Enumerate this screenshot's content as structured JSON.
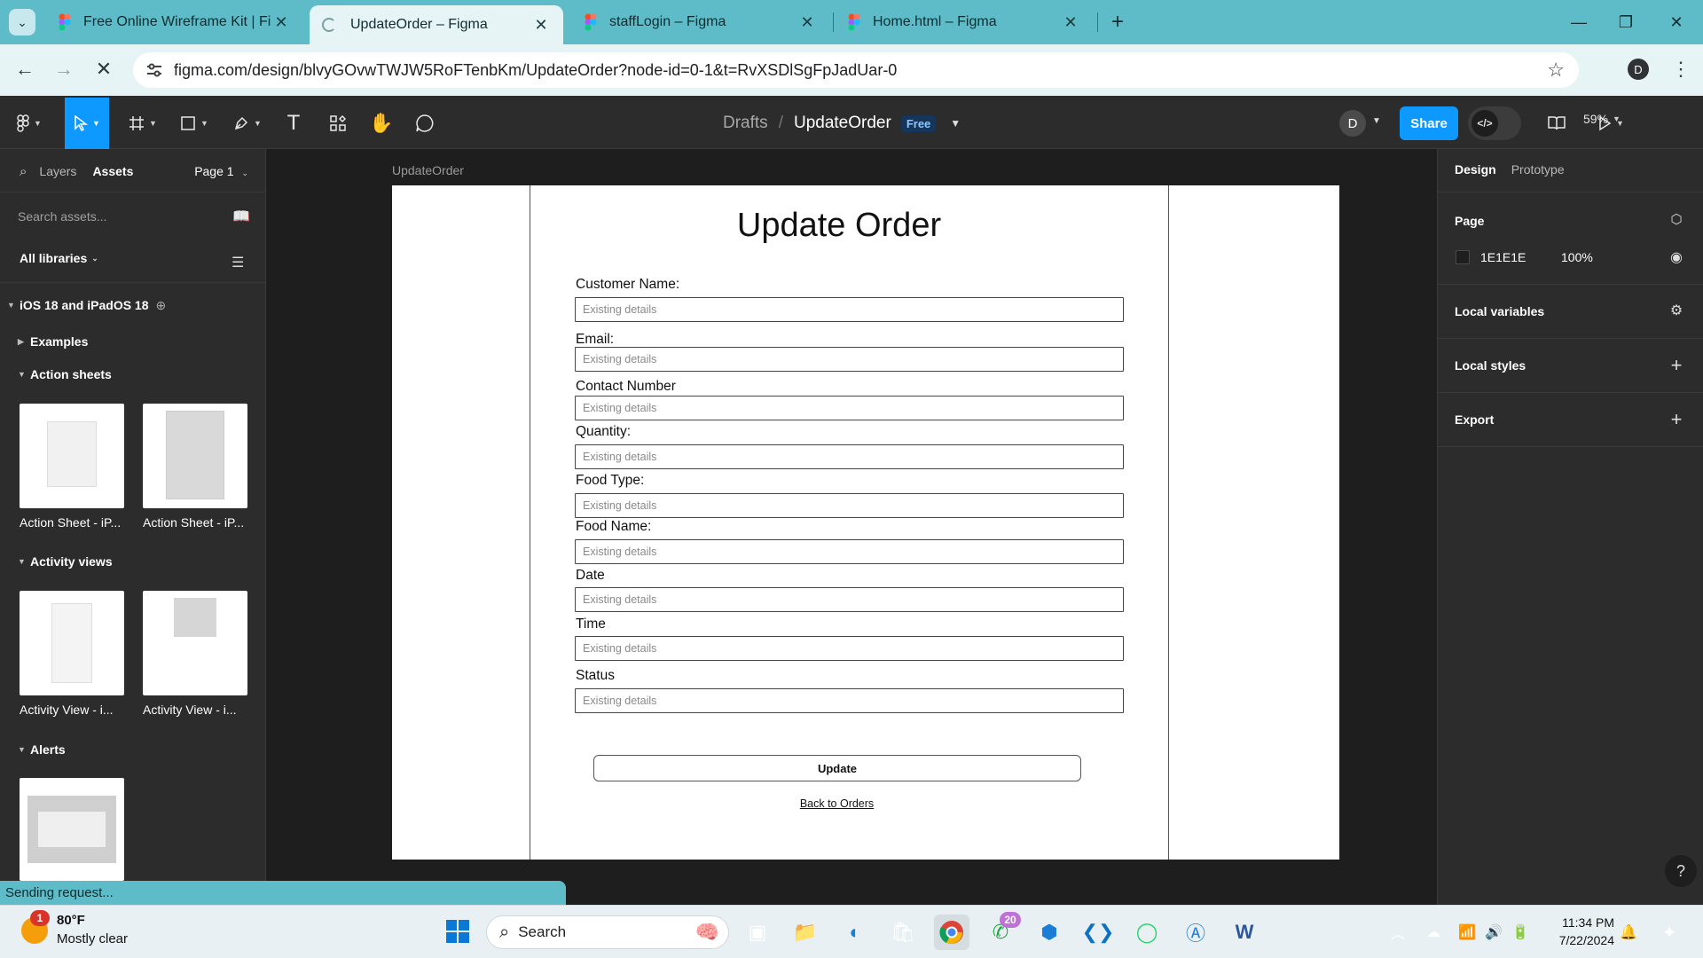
{
  "browser": {
    "tabs": [
      {
        "title": "Free Online Wireframe Kit | Figma",
        "active": false
      },
      {
        "title": "UpdateOrder – Figma",
        "active": true
      },
      {
        "title": "staffLogin – Figma",
        "active": false
      },
      {
        "title": "Home.html – Figma",
        "active": false
      }
    ],
    "url": "figma.com/design/blvyGOvwTWJW5RoFTenbKm/UpdateOrder?node-id=0-1&t=RvXSDlSgFpJadUar-0",
    "profile_initial": "D"
  },
  "toolbar": {
    "breadcrumb_parent": "Drafts",
    "file_name": "UpdateOrder",
    "plan_badge": "Free",
    "avatar_initial": "D",
    "share_label": "Share",
    "zoom": "59%"
  },
  "left_panel": {
    "tabs": {
      "layers": "Layers",
      "assets": "Assets",
      "page": "Page 1"
    },
    "search_placeholder": "Search assets...",
    "libraries_label": "All libraries",
    "library_name": "iOS 18 and iPadOS 18",
    "sections": {
      "examples": "Examples",
      "action_sheets": "Action sheets",
      "activity_views": "Activity views",
      "alerts": "Alerts"
    },
    "thumbs": {
      "action_sheet_1": "Action Sheet - iP...",
      "action_sheet_2": "Action Sheet - iP...",
      "activity_view_1": "Activity View - i...",
      "activity_view_2": "Activity View - i..."
    }
  },
  "canvas": {
    "frame_label": "UpdateOrder",
    "form": {
      "title": "Update Order",
      "fields": [
        {
          "label": "Customer Name:",
          "placeholder": "Existing details"
        },
        {
          "label": "Email:",
          "placeholder": "Existing details"
        },
        {
          "label": "Contact Number",
          "placeholder": "Existing details"
        },
        {
          "label": "Quantity:",
          "placeholder": "Existing details"
        },
        {
          "label": "Food Type:",
          "placeholder": "Existing details"
        },
        {
          "label": "Food Name:",
          "placeholder": "Existing details"
        },
        {
          "label": "Date",
          "placeholder": "Existing details"
        },
        {
          "label": "Time",
          "placeholder": "Existing details"
        },
        {
          "label": "Status",
          "placeholder": "Existing details"
        }
      ],
      "update_label": "Update",
      "back_link": "Back to Orders"
    }
  },
  "right_panel": {
    "tabs": {
      "design": "Design",
      "prototype": "Prototype"
    },
    "page_heading": "Page",
    "page_color": "1E1E1E",
    "page_opacity": "100%",
    "local_variables": "Local variables",
    "local_styles": "Local styles",
    "export": "Export",
    "help": "?"
  },
  "status_text": "Sending request...",
  "taskbar": {
    "weather_temp": "80°F",
    "weather_desc": "Mostly clear",
    "weather_alert_count": "1",
    "search_label": "Search",
    "whatsapp_badge": "20",
    "time": "11:34 PM",
    "date": "7/22/2024"
  },
  "colors": {
    "browser_chrome": "#5ebcc8",
    "figma_accent": "#0d99ff",
    "canvas_bg": "#1e1e1e",
    "panel_bg": "#2c2c2c"
  }
}
